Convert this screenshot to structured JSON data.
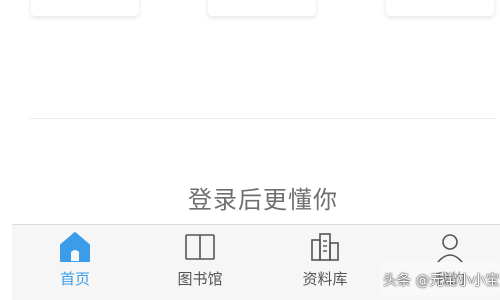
{
  "main": {
    "login_hint": "登录后更懂你"
  },
  "tabbar": {
    "active_color": "#3b9dea",
    "inactive_color": "#555555",
    "items": [
      {
        "label": "首页",
        "icon": "home-icon",
        "active": true
      },
      {
        "label": "图书馆",
        "icon": "book-icon",
        "active": false
      },
      {
        "label": "资料库",
        "icon": "building-icon",
        "active": false
      },
      {
        "label": "我的",
        "icon": "person-icon",
        "active": false
      }
    ]
  },
  "watermark": {
    "text": "头条 @元宝小小宝"
  }
}
